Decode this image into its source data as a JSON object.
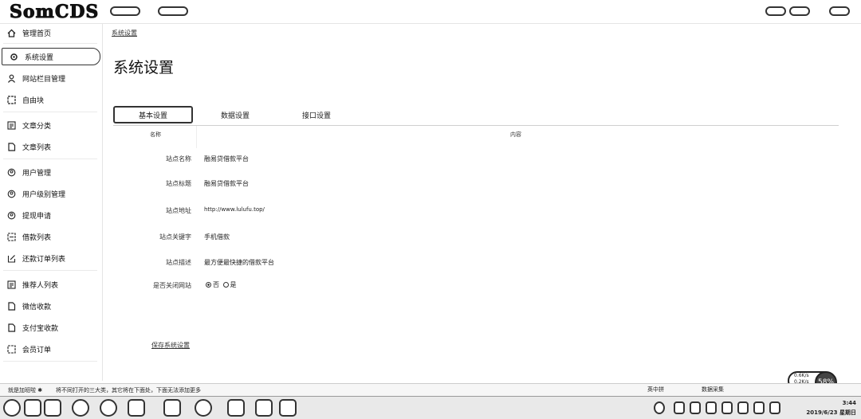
{
  "app": {
    "logo_text": "SomCDS"
  },
  "sidebar": {
    "items": [
      {
        "label": "管理首页",
        "icon": "home-icon"
      },
      {
        "label": "系统设置",
        "icon": "gear-icon",
        "active": true
      },
      {
        "label": "网站栏目管理",
        "icon": "user-icon"
      },
      {
        "label": "自由块",
        "icon": "square-icon"
      },
      {
        "label": "文章分类",
        "icon": "list-icon"
      },
      {
        "label": "文章列表",
        "icon": "document-icon"
      },
      {
        "label": "用户管理",
        "icon": "user-icon"
      },
      {
        "label": "用户级别管理",
        "icon": "user-icon"
      },
      {
        "label": "提现申请",
        "icon": "user-icon"
      },
      {
        "label": "借款列表",
        "icon": "list-icon"
      },
      {
        "label": "还款订单列表",
        "icon": "edit-icon"
      },
      {
        "label": "推荐人列表",
        "icon": "list-icon"
      },
      {
        "label": "微信收款",
        "icon": "document-icon"
      },
      {
        "label": "支付宝收款",
        "icon": "document-icon"
      },
      {
        "label": "会员订单",
        "icon": "list-icon"
      }
    ]
  },
  "main": {
    "breadcrumb": "系统设置",
    "title": "系统设置",
    "tabs": [
      "基本设置",
      "数据设置",
      "接口设置"
    ],
    "table_headers": {
      "name": "名称",
      "content": "内容"
    },
    "rows": [
      {
        "label": "站点名称",
        "value": "融易贷借款平台"
      },
      {
        "label": "站点标题",
        "value": "融易贷借款平台"
      },
      {
        "label": "站点地址",
        "value": "http://www.lulufu.top/"
      },
      {
        "label": "站点关键字",
        "value": "手机借款"
      },
      {
        "label": "站点描述",
        "value": "最方便最快捷的借款平台"
      },
      {
        "label": "是否关闭网站",
        "value": ""
      }
    ],
    "radio_options": [
      "否",
      "是"
    ],
    "save_button": "保存系统设置"
  },
  "float_widget": {
    "line1": "0.6K/s",
    "line2": "0.2K/s",
    "percent": "58%"
  },
  "statusbar": {
    "left": "就是加班啦 ✱",
    "message": "将不同打开的三大类，其它将在下面处，下面无法添加更多"
  },
  "taskbar": {
    "tray_text_1": "英中拼",
    "tray_text_2": "数据采集",
    "clock_time": "3:44",
    "clock_date": "2019/6/23 星期日"
  }
}
